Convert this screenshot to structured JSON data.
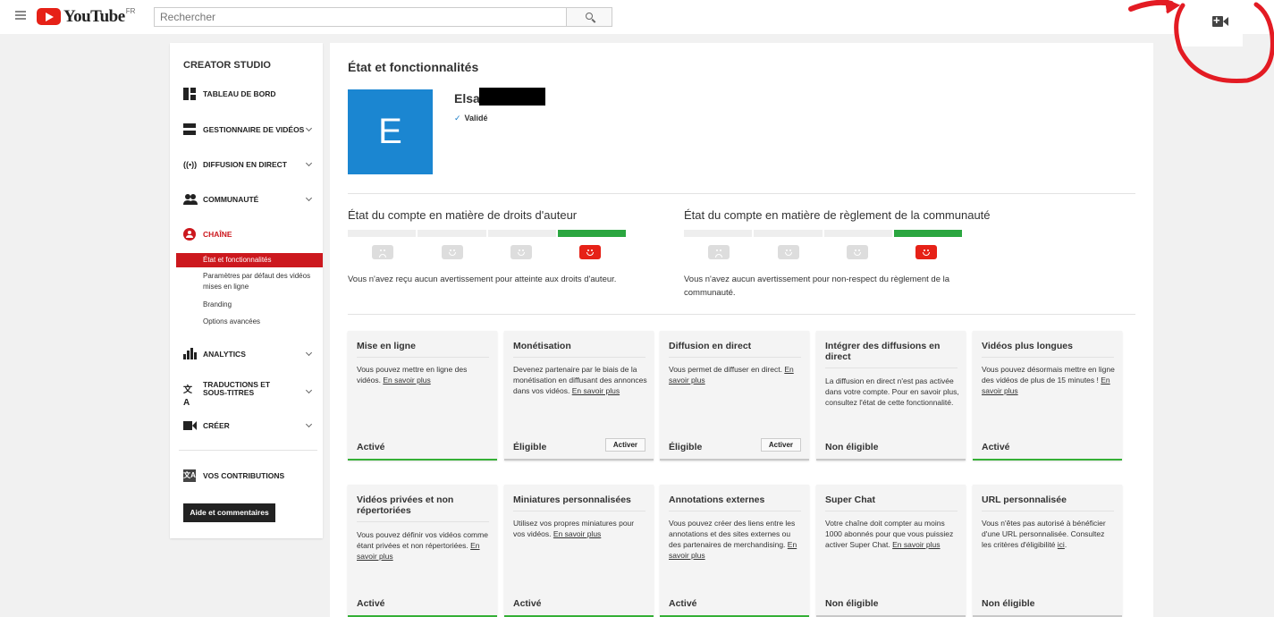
{
  "topbar": {
    "logo_text": "YouTube",
    "logo_country": "FR",
    "search_placeholder": "Rechercher"
  },
  "sidebar": {
    "title": "CREATOR STUDIO",
    "items": {
      "dashboard": "TABLEAU DE BORD",
      "videos": "GESTIONNAIRE DE VIDÉOS",
      "live": "DIFFUSION EN DIRECT",
      "community": "COMMUNAUTÉ",
      "channel": "CHAÎNE",
      "analytics": "ANALYTICS",
      "translations_1": "TRADUCTIONS ET",
      "translations_2": "SOUS-TITRES",
      "create": "CRÉER",
      "contributions": "VOS CONTRIBUTIONS"
    },
    "channel_sub": {
      "status": "État et fonctionnalités",
      "defaults": "Paramètres par défaut des vidéos mises en ligne",
      "branding": "Branding",
      "advanced": "Options avancées"
    },
    "help_button": "Aide et commentaires",
    "icons": {
      "live": "((•))",
      "translations": "文A",
      "contributions": "文A"
    }
  },
  "main": {
    "title": "État et fonctionnalités",
    "account": {
      "avatar_letter": "E",
      "name": "Elsa",
      "verified": "Validé",
      "check": "✓",
      "avatar_color": "#1b86d1"
    },
    "copyright": {
      "title": "État du compte en matière de droits d'auteur",
      "text": "Vous n'avez reçu aucun avertissement pour atteinte aux droits d'auteur."
    },
    "community": {
      "title": "État du compte en matière de règlement de la communauté",
      "text": "Vous n'avez aucun avertissement pour non-respect du règlement de la communauté."
    },
    "features": [
      {
        "title": "Mise en ligne",
        "desc": "Vous pouvez mettre en ligne des vidéos.",
        "link": "En savoir plus",
        "status": "Activé"
      },
      {
        "title": "Monétisation",
        "desc": "Devenez partenaire par le biais de la monétisation en diffusant des annonces dans vos vidéos.",
        "link": "En savoir plus",
        "status": "Éligible",
        "button": "Activer"
      },
      {
        "title": "Diffusion en direct",
        "desc": "Vous permet de diffuser en direct.",
        "link": "En savoir plus",
        "status": "Éligible",
        "button": "Activer"
      },
      {
        "title": "Intégrer des diffusions en direct",
        "desc": "La diffusion en direct n'est pas activée dans votre compte. Pour en savoir plus, consultez l'état de cette fonctionnalité.",
        "status": "Non éligible"
      },
      {
        "title": "Vidéos plus longues",
        "desc": "Vous pouvez désormais mettre en ligne des vidéos de plus de 15 minutes !",
        "link": "En savoir plus",
        "status": "Activé"
      },
      {
        "title": "Vidéos privées et non répertoriées",
        "desc": "Vous pouvez définir vos vidéos comme étant privées et non répertoriées.",
        "link": "En savoir plus",
        "status": "Activé"
      },
      {
        "title": "Miniatures personnalisées",
        "desc": "Utilisez vos propres miniatures pour vos vidéos.",
        "link": "En savoir plus",
        "status": "Activé"
      },
      {
        "title": "Annotations externes",
        "desc": "Vous pouvez créer des liens entre les annotations et des sites externes ou des partenaires de merchandising.",
        "link": "En savoir plus",
        "status": "Activé"
      },
      {
        "title": "Super Chat",
        "desc": "Votre chaîne doit compter au moins 1000 abonnés pour que vous puissiez activer Super Chat.",
        "link": "En savoir plus",
        "status": "Non éligible"
      },
      {
        "title": "URL personnalisée",
        "desc": "Vous n'êtes pas autorisé à bénéficier d'une URL personnalisée. Consultez les critères d'éligibilité",
        "link": "ici",
        "status": "Non éligible"
      }
    ]
  },
  "colors": {
    "youtube_red": "#e62117",
    "active_nav": "#cc181e",
    "enabled_green": "#35b036",
    "strike_green": "#2ba640"
  }
}
